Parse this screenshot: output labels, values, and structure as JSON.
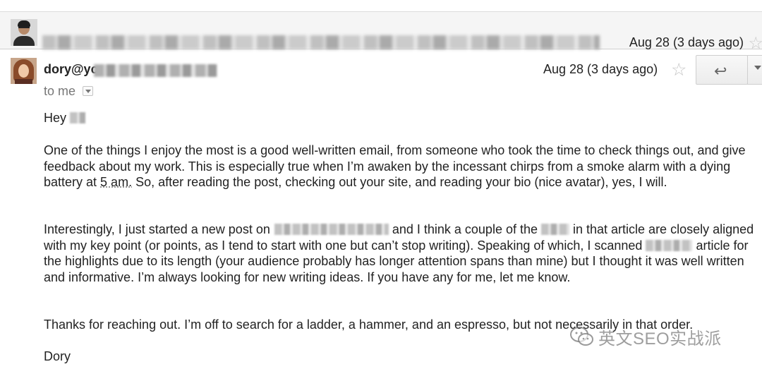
{
  "thread": {
    "collapsed_message": {
      "date": "Aug 28 (3 days ago)"
    },
    "message": {
      "sender_name": "dory@yc",
      "date": "Aug 28 (3 days ago)",
      "recipient": "to me",
      "body": {
        "greeting": "Hey",
        "paragraph1": "One of the things I enjoy the most is a good well-written email, from someone who took the time to check things out, and give feedback about my work. This is especially true when I’m awaken by the incessant chirps from a smoke alarm with a dying battery at 5 am. So, after reading the post, checking out your site, and reading your bio (nice avatar), yes, I will.",
        "paragraph1_part_a": "One of the things I enjoy the most is a good well-written email, from someone who took the time to check things out, and give feedback about my work. This is especially true when I’m awaken by the incessant chirps from a smoke alarm with a dying battery at ",
        "paragraph1_time": "5 am.",
        "paragraph1_part_b": " So, after reading the post, checking out your site, and reading your bio (nice avatar), yes, I will.",
        "paragraph2_part_a": "Interestingly, I just started a new post on",
        "paragraph2_part_b": " and I think a couple of the ",
        "paragraph2_part_c": " in that article are closely aligned with my key point (or points, as I tend to start with one but can’t stop writing). Speaking of which, I scanned ",
        "paragraph2_part_d": " article for the highlights due to its length (your audience probably has longer attention spans than mine) but I thought it was well written and informative. I’m always looking for new writing ideas. If you have any for me, let me know.",
        "paragraph3": "Thanks for reaching out. I’m off to search for a ladder,  a hammer, and an espresso, but not necessarily in that order.",
        "signature": "Dory"
      }
    }
  },
  "watermark": {
    "text": "英文SEO实战派"
  },
  "icons": {
    "star": "star-icon",
    "reply": "reply-arrow-icon",
    "more": "chevron-down-icon",
    "toggle": "details-toggle-icon"
  }
}
